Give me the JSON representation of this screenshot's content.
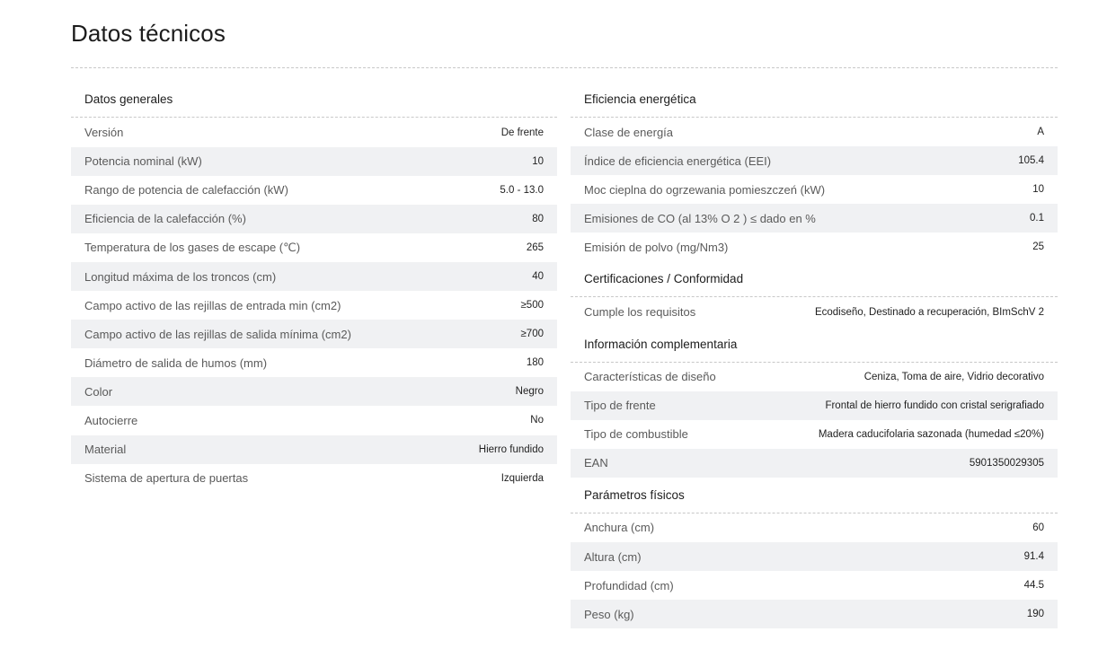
{
  "page": {
    "title": "Datos técnicos"
  },
  "colors": {
    "stripe": "#f0f1f3",
    "divider": "#c8c8c8",
    "text": "#1c1c1c",
    "label": "#5a5a5a"
  },
  "left_sections": [
    {
      "heading": "Datos generales",
      "rows": [
        {
          "label": "Versión",
          "value": "De frente"
        },
        {
          "label": "Potencia nominal (kW)",
          "value": "10"
        },
        {
          "label": "Rango de potencia de calefacción (kW)",
          "value": "5.0 - 13.0"
        },
        {
          "label": "Eficiencia de la calefacción (%)",
          "value": "80"
        },
        {
          "label": "Temperatura de los gases de escape (℃)",
          "value": "265"
        },
        {
          "label": "Longitud máxima de los troncos (cm)",
          "value": "40"
        },
        {
          "label": "Campo activo de las rejillas de entrada min (cm2)",
          "value": "≥500"
        },
        {
          "label": "Campo activo de las rejillas de salida mínima (cm2)",
          "value": "≥700"
        },
        {
          "label": "Diámetro de salida de humos (mm)",
          "value": "180"
        },
        {
          "label": "Color",
          "value": "Negro"
        },
        {
          "label": "Autocierre",
          "value": "No"
        },
        {
          "label": "Material",
          "value": "Hierro fundido"
        },
        {
          "label": "Sistema de apertura de puertas",
          "value": "Izquierda"
        }
      ]
    }
  ],
  "right_sections": [
    {
      "heading": "Eficiencia energética",
      "rows": [
        {
          "label": "Clase de energía",
          "value": "A"
        },
        {
          "label": "Índice de eficiencia energética (EEI)",
          "value": "105.4"
        },
        {
          "label": "Moc cieplna do ogrzewania pomieszczeń (kW)",
          "value": "10"
        },
        {
          "label": "Emisiones de CO (al 13% O 2 ) ≤ dado en %",
          "value": "0.1"
        },
        {
          "label": "Emisión de polvo (mg/Nm3)",
          "value": "25"
        }
      ]
    },
    {
      "heading": "Certificaciones / Conformidad",
      "rows": [
        {
          "label": "Cumple los requisitos",
          "value": "Ecodiseño, Destinado a recuperación, BImSchV 2"
        }
      ]
    },
    {
      "heading": "Información complementaria",
      "rows": [
        {
          "label": "Características de diseño",
          "value": "Ceniza, Toma de aire, Vidrio decorativo"
        },
        {
          "label": "Tipo de frente",
          "value": "Frontal de hierro fundido con cristal serigrafiado"
        },
        {
          "label": "Tipo de combustible",
          "value": "Madera caducifolaria sazonada (humedad ≤20%)"
        },
        {
          "label": "EAN",
          "value": "5901350029305"
        }
      ]
    },
    {
      "heading": "Parámetros físicos",
      "rows": [
        {
          "label": "Anchura (cm)",
          "value": "60"
        },
        {
          "label": "Altura (cm)",
          "value": "91.4"
        },
        {
          "label": "Profundidad (cm)",
          "value": "44.5"
        },
        {
          "label": "Peso (kg)",
          "value": "190"
        }
      ]
    }
  ]
}
